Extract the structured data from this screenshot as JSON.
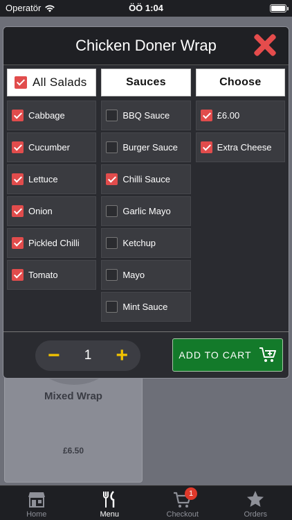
{
  "status_bar": {
    "carrier": "Operatör",
    "time": "ÖÖ 1:04",
    "battery_level": 1.0
  },
  "background": {
    "card_title": "Mixed Wrap",
    "card_price": "£6.50"
  },
  "modal": {
    "title": "Chicken Doner Wrap",
    "columns": {
      "salads": {
        "header": "All Salads",
        "header_checked": true,
        "items": [
          {
            "label": "Cabbage",
            "checked": true
          },
          {
            "label": "Cucumber",
            "checked": true
          },
          {
            "label": "Lettuce",
            "checked": true
          },
          {
            "label": "Onion",
            "checked": true
          },
          {
            "label": "Pickled Chilli",
            "checked": true
          },
          {
            "label": "Tomato",
            "checked": true
          }
        ]
      },
      "sauces": {
        "header": "Sauces",
        "items": [
          {
            "label": "BBQ Sauce",
            "checked": false
          },
          {
            "label": "Burger Sauce",
            "checked": false
          },
          {
            "label": "Chilli Sauce",
            "checked": true
          },
          {
            "label": "Garlic Mayo",
            "checked": false
          },
          {
            "label": "Ketchup",
            "checked": false
          },
          {
            "label": "Mayo",
            "checked": false
          },
          {
            "label": "Mint Sauce",
            "checked": false
          }
        ]
      },
      "choose": {
        "header": "Choose",
        "items": [
          {
            "label": "£6.00",
            "checked": true
          },
          {
            "label": "Extra Cheese",
            "checked": true
          }
        ]
      }
    },
    "quantity": {
      "minus": "−",
      "value": "1",
      "plus": "+"
    },
    "add_to_cart_label": "ADD TO CART"
  },
  "tabbar": {
    "tabs": [
      {
        "label": "Home",
        "icon": "store-icon",
        "active": false
      },
      {
        "label": "Menu",
        "icon": "cutlery-icon",
        "active": true
      },
      {
        "label": "Checkout",
        "icon": "cart-icon",
        "active": false,
        "badge": "1"
      },
      {
        "label": "Orders",
        "icon": "star-icon",
        "active": false
      }
    ]
  },
  "colors": {
    "accent_red": "#e14c4c",
    "cart_green": "#137a2a",
    "qty_yellow": "#f2c300"
  }
}
